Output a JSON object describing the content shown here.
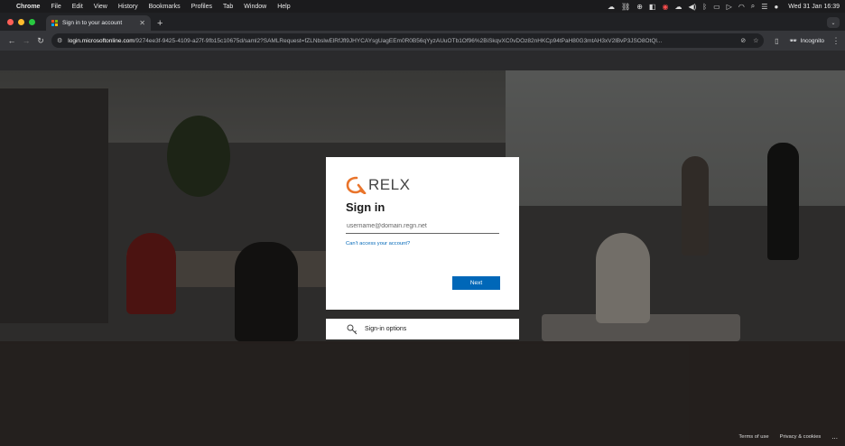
{
  "menubar": {
    "items": [
      "Chrome",
      "File",
      "Edit",
      "View",
      "History",
      "Bookmarks",
      "Profiles",
      "Tab",
      "Window",
      "Help"
    ],
    "clock": "Wed 31 Jan 16:39"
  },
  "browser": {
    "tab_title": "Sign in to your account",
    "url_host": "login.microsoftonline.com",
    "url_path": "/9274ee3f-9425-4109-a27f-9fb15c10675d/saml2?SAMLRequest=fZLNbslwElRfJfl9JHYCAYsgUagEEm0R0B56qYyzAUuOTb1Of96%2BiSkqvXC0vDOz82nHKCp94tPaH80G3mtAH3xV2lBvP3JSO8OtQl...",
    "incognito_label": "Incognito"
  },
  "signin": {
    "brand": "RELX",
    "heading": "Sign in",
    "username_placeholder": "username@domain.regn.net",
    "cant_access": "Can’t access your account?",
    "next_label": "Next",
    "options_label": "Sign-in options"
  },
  "footer": {
    "terms": "Terms of use",
    "privacy": "Privacy & cookies",
    "more": "..."
  },
  "colors": {
    "accent": "#0067b8",
    "relx_orange": "#e9742b"
  }
}
